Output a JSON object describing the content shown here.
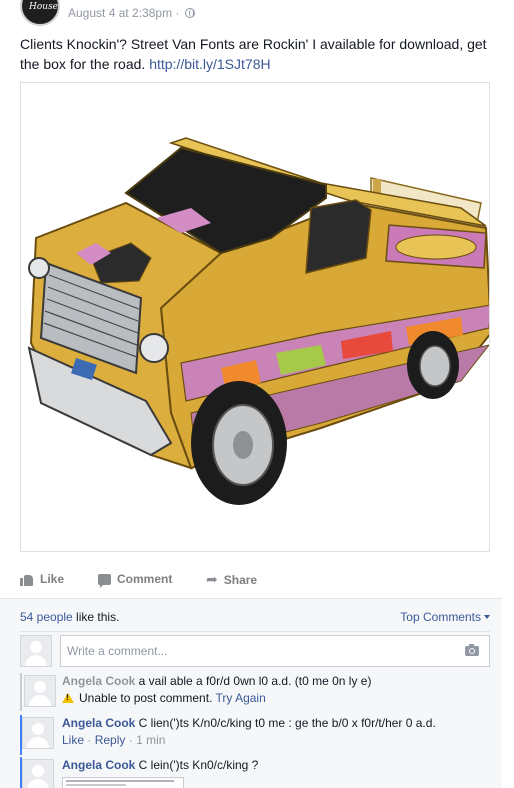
{
  "post": {
    "timestamp": "August 4 at 2:38pm",
    "separator": "·",
    "text": "Clients Knockin'? Street Van Fonts are Rockin' I available for download, get the box for the road.",
    "link": "http://bit.ly/1SJt78H",
    "image_alt": "illustrated custom van model box"
  },
  "actions": {
    "like": "Like",
    "comment": "Comment",
    "share": "Share"
  },
  "comments_panel": {
    "likes_count": "54 people",
    "likes_suffix": " like this.",
    "sort_label": "Top Comments",
    "input_placeholder": "Write a comment...",
    "comments": [
      {
        "author": "Angela Cook",
        "text": " a vail able a f0r/d 0wn l0 a.d. (t0 me 0n ly e)",
        "error": "Unable to post comment.",
        "retry": "Try Again"
      },
      {
        "author": "Angela Cook",
        "text": " C lien(')ts K/n0/c/king t0 me : ge the b/0 x f0r/t/her 0 a.d.",
        "like": "Like",
        "reply": "Reply",
        "time": "1 min"
      },
      {
        "author": "Angela Cook",
        "text": " C lein(')ts Kn0/c/king ?"
      }
    ]
  },
  "colors": {
    "link": "#3b5998",
    "meta": "#9197a3",
    "van_gold": "#d9a93a",
    "van_pink": "#c87fb4"
  },
  "icons": [
    "globe-icon",
    "like-icon",
    "comment-icon",
    "share-icon",
    "camera-icon",
    "warning-icon"
  ]
}
